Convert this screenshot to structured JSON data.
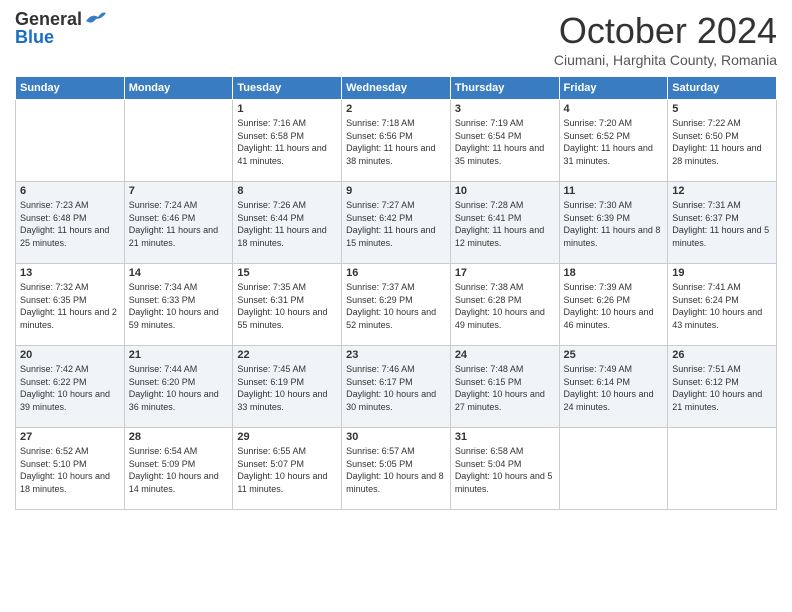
{
  "header": {
    "logo_general": "General",
    "logo_blue": "Blue",
    "month_title": "October 2024",
    "subtitle": "Ciumani, Harghita County, Romania"
  },
  "days_of_week": [
    "Sunday",
    "Monday",
    "Tuesday",
    "Wednesday",
    "Thursday",
    "Friday",
    "Saturday"
  ],
  "weeks": [
    [
      {
        "day": "",
        "info": ""
      },
      {
        "day": "",
        "info": ""
      },
      {
        "day": "1",
        "info": "Sunrise: 7:16 AM\nSunset: 6:58 PM\nDaylight: 11 hours and 41 minutes."
      },
      {
        "day": "2",
        "info": "Sunrise: 7:18 AM\nSunset: 6:56 PM\nDaylight: 11 hours and 38 minutes."
      },
      {
        "day": "3",
        "info": "Sunrise: 7:19 AM\nSunset: 6:54 PM\nDaylight: 11 hours and 35 minutes."
      },
      {
        "day": "4",
        "info": "Sunrise: 7:20 AM\nSunset: 6:52 PM\nDaylight: 11 hours and 31 minutes."
      },
      {
        "day": "5",
        "info": "Sunrise: 7:22 AM\nSunset: 6:50 PM\nDaylight: 11 hours and 28 minutes."
      }
    ],
    [
      {
        "day": "6",
        "info": "Sunrise: 7:23 AM\nSunset: 6:48 PM\nDaylight: 11 hours and 25 minutes."
      },
      {
        "day": "7",
        "info": "Sunrise: 7:24 AM\nSunset: 6:46 PM\nDaylight: 11 hours and 21 minutes."
      },
      {
        "day": "8",
        "info": "Sunrise: 7:26 AM\nSunset: 6:44 PM\nDaylight: 11 hours and 18 minutes."
      },
      {
        "day": "9",
        "info": "Sunrise: 7:27 AM\nSunset: 6:42 PM\nDaylight: 11 hours and 15 minutes."
      },
      {
        "day": "10",
        "info": "Sunrise: 7:28 AM\nSunset: 6:41 PM\nDaylight: 11 hours and 12 minutes."
      },
      {
        "day": "11",
        "info": "Sunrise: 7:30 AM\nSunset: 6:39 PM\nDaylight: 11 hours and 8 minutes."
      },
      {
        "day": "12",
        "info": "Sunrise: 7:31 AM\nSunset: 6:37 PM\nDaylight: 11 hours and 5 minutes."
      }
    ],
    [
      {
        "day": "13",
        "info": "Sunrise: 7:32 AM\nSunset: 6:35 PM\nDaylight: 11 hours and 2 minutes."
      },
      {
        "day": "14",
        "info": "Sunrise: 7:34 AM\nSunset: 6:33 PM\nDaylight: 10 hours and 59 minutes."
      },
      {
        "day": "15",
        "info": "Sunrise: 7:35 AM\nSunset: 6:31 PM\nDaylight: 10 hours and 55 minutes."
      },
      {
        "day": "16",
        "info": "Sunrise: 7:37 AM\nSunset: 6:29 PM\nDaylight: 10 hours and 52 minutes."
      },
      {
        "day": "17",
        "info": "Sunrise: 7:38 AM\nSunset: 6:28 PM\nDaylight: 10 hours and 49 minutes."
      },
      {
        "day": "18",
        "info": "Sunrise: 7:39 AM\nSunset: 6:26 PM\nDaylight: 10 hours and 46 minutes."
      },
      {
        "day": "19",
        "info": "Sunrise: 7:41 AM\nSunset: 6:24 PM\nDaylight: 10 hours and 43 minutes."
      }
    ],
    [
      {
        "day": "20",
        "info": "Sunrise: 7:42 AM\nSunset: 6:22 PM\nDaylight: 10 hours and 39 minutes."
      },
      {
        "day": "21",
        "info": "Sunrise: 7:44 AM\nSunset: 6:20 PM\nDaylight: 10 hours and 36 minutes."
      },
      {
        "day": "22",
        "info": "Sunrise: 7:45 AM\nSunset: 6:19 PM\nDaylight: 10 hours and 33 minutes."
      },
      {
        "day": "23",
        "info": "Sunrise: 7:46 AM\nSunset: 6:17 PM\nDaylight: 10 hours and 30 minutes."
      },
      {
        "day": "24",
        "info": "Sunrise: 7:48 AM\nSunset: 6:15 PM\nDaylight: 10 hours and 27 minutes."
      },
      {
        "day": "25",
        "info": "Sunrise: 7:49 AM\nSunset: 6:14 PM\nDaylight: 10 hours and 24 minutes."
      },
      {
        "day": "26",
        "info": "Sunrise: 7:51 AM\nSunset: 6:12 PM\nDaylight: 10 hours and 21 minutes."
      }
    ],
    [
      {
        "day": "27",
        "info": "Sunrise: 6:52 AM\nSunset: 5:10 PM\nDaylight: 10 hours and 18 minutes."
      },
      {
        "day": "28",
        "info": "Sunrise: 6:54 AM\nSunset: 5:09 PM\nDaylight: 10 hours and 14 minutes."
      },
      {
        "day": "29",
        "info": "Sunrise: 6:55 AM\nSunset: 5:07 PM\nDaylight: 10 hours and 11 minutes."
      },
      {
        "day": "30",
        "info": "Sunrise: 6:57 AM\nSunset: 5:05 PM\nDaylight: 10 hours and 8 minutes."
      },
      {
        "day": "31",
        "info": "Sunrise: 6:58 AM\nSunset: 5:04 PM\nDaylight: 10 hours and 5 minutes."
      },
      {
        "day": "",
        "info": ""
      },
      {
        "day": "",
        "info": ""
      }
    ]
  ]
}
